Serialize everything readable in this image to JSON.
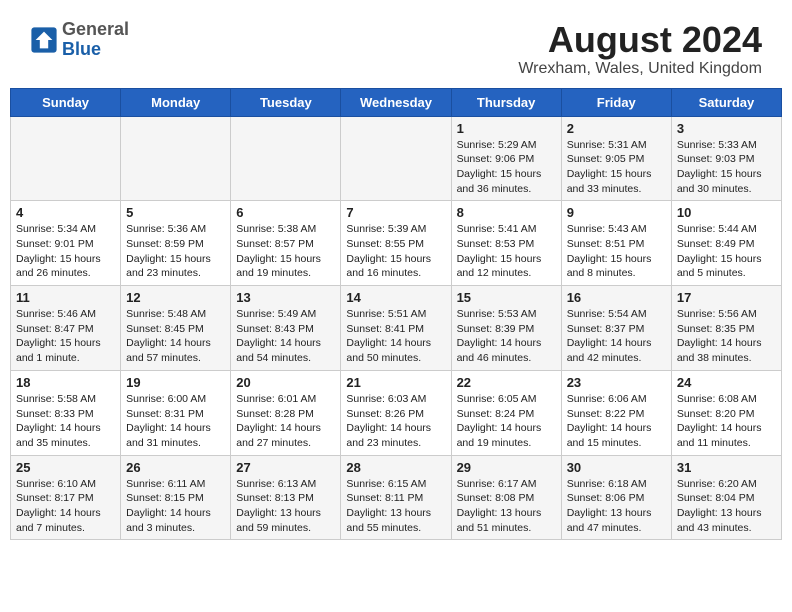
{
  "header": {
    "logo_general": "General",
    "logo_blue": "Blue",
    "month_title": "August 2024",
    "location": "Wrexham, Wales, United Kingdom"
  },
  "days_of_week": [
    "Sunday",
    "Monday",
    "Tuesday",
    "Wednesday",
    "Thursday",
    "Friday",
    "Saturday"
  ],
  "weeks": [
    [
      {
        "day": "",
        "info": ""
      },
      {
        "day": "",
        "info": ""
      },
      {
        "day": "",
        "info": ""
      },
      {
        "day": "",
        "info": ""
      },
      {
        "day": "1",
        "info": "Sunrise: 5:29 AM\nSunset: 9:06 PM\nDaylight: 15 hours\nand 36 minutes."
      },
      {
        "day": "2",
        "info": "Sunrise: 5:31 AM\nSunset: 9:05 PM\nDaylight: 15 hours\nand 33 minutes."
      },
      {
        "day": "3",
        "info": "Sunrise: 5:33 AM\nSunset: 9:03 PM\nDaylight: 15 hours\nand 30 minutes."
      }
    ],
    [
      {
        "day": "4",
        "info": "Sunrise: 5:34 AM\nSunset: 9:01 PM\nDaylight: 15 hours\nand 26 minutes."
      },
      {
        "day": "5",
        "info": "Sunrise: 5:36 AM\nSunset: 8:59 PM\nDaylight: 15 hours\nand 23 minutes."
      },
      {
        "day": "6",
        "info": "Sunrise: 5:38 AM\nSunset: 8:57 PM\nDaylight: 15 hours\nand 19 minutes."
      },
      {
        "day": "7",
        "info": "Sunrise: 5:39 AM\nSunset: 8:55 PM\nDaylight: 15 hours\nand 16 minutes."
      },
      {
        "day": "8",
        "info": "Sunrise: 5:41 AM\nSunset: 8:53 PM\nDaylight: 15 hours\nand 12 minutes."
      },
      {
        "day": "9",
        "info": "Sunrise: 5:43 AM\nSunset: 8:51 PM\nDaylight: 15 hours\nand 8 minutes."
      },
      {
        "day": "10",
        "info": "Sunrise: 5:44 AM\nSunset: 8:49 PM\nDaylight: 15 hours\nand 5 minutes."
      }
    ],
    [
      {
        "day": "11",
        "info": "Sunrise: 5:46 AM\nSunset: 8:47 PM\nDaylight: 15 hours\nand 1 minute."
      },
      {
        "day": "12",
        "info": "Sunrise: 5:48 AM\nSunset: 8:45 PM\nDaylight: 14 hours\nand 57 minutes."
      },
      {
        "day": "13",
        "info": "Sunrise: 5:49 AM\nSunset: 8:43 PM\nDaylight: 14 hours\nand 54 minutes."
      },
      {
        "day": "14",
        "info": "Sunrise: 5:51 AM\nSunset: 8:41 PM\nDaylight: 14 hours\nand 50 minutes."
      },
      {
        "day": "15",
        "info": "Sunrise: 5:53 AM\nSunset: 8:39 PM\nDaylight: 14 hours\nand 46 minutes."
      },
      {
        "day": "16",
        "info": "Sunrise: 5:54 AM\nSunset: 8:37 PM\nDaylight: 14 hours\nand 42 minutes."
      },
      {
        "day": "17",
        "info": "Sunrise: 5:56 AM\nSunset: 8:35 PM\nDaylight: 14 hours\nand 38 minutes."
      }
    ],
    [
      {
        "day": "18",
        "info": "Sunrise: 5:58 AM\nSunset: 8:33 PM\nDaylight: 14 hours\nand 35 minutes."
      },
      {
        "day": "19",
        "info": "Sunrise: 6:00 AM\nSunset: 8:31 PM\nDaylight: 14 hours\nand 31 minutes."
      },
      {
        "day": "20",
        "info": "Sunrise: 6:01 AM\nSunset: 8:28 PM\nDaylight: 14 hours\nand 27 minutes."
      },
      {
        "day": "21",
        "info": "Sunrise: 6:03 AM\nSunset: 8:26 PM\nDaylight: 14 hours\nand 23 minutes."
      },
      {
        "day": "22",
        "info": "Sunrise: 6:05 AM\nSunset: 8:24 PM\nDaylight: 14 hours\nand 19 minutes."
      },
      {
        "day": "23",
        "info": "Sunrise: 6:06 AM\nSunset: 8:22 PM\nDaylight: 14 hours\nand 15 minutes."
      },
      {
        "day": "24",
        "info": "Sunrise: 6:08 AM\nSunset: 8:20 PM\nDaylight: 14 hours\nand 11 minutes."
      }
    ],
    [
      {
        "day": "25",
        "info": "Sunrise: 6:10 AM\nSunset: 8:17 PM\nDaylight: 14 hours\nand 7 minutes."
      },
      {
        "day": "26",
        "info": "Sunrise: 6:11 AM\nSunset: 8:15 PM\nDaylight: 14 hours\nand 3 minutes."
      },
      {
        "day": "27",
        "info": "Sunrise: 6:13 AM\nSunset: 8:13 PM\nDaylight: 13 hours\nand 59 minutes."
      },
      {
        "day": "28",
        "info": "Sunrise: 6:15 AM\nSunset: 8:11 PM\nDaylight: 13 hours\nand 55 minutes."
      },
      {
        "day": "29",
        "info": "Sunrise: 6:17 AM\nSunset: 8:08 PM\nDaylight: 13 hours\nand 51 minutes."
      },
      {
        "day": "30",
        "info": "Sunrise: 6:18 AM\nSunset: 8:06 PM\nDaylight: 13 hours\nand 47 minutes."
      },
      {
        "day": "31",
        "info": "Sunrise: 6:20 AM\nSunset: 8:04 PM\nDaylight: 13 hours\nand 43 minutes."
      }
    ]
  ]
}
